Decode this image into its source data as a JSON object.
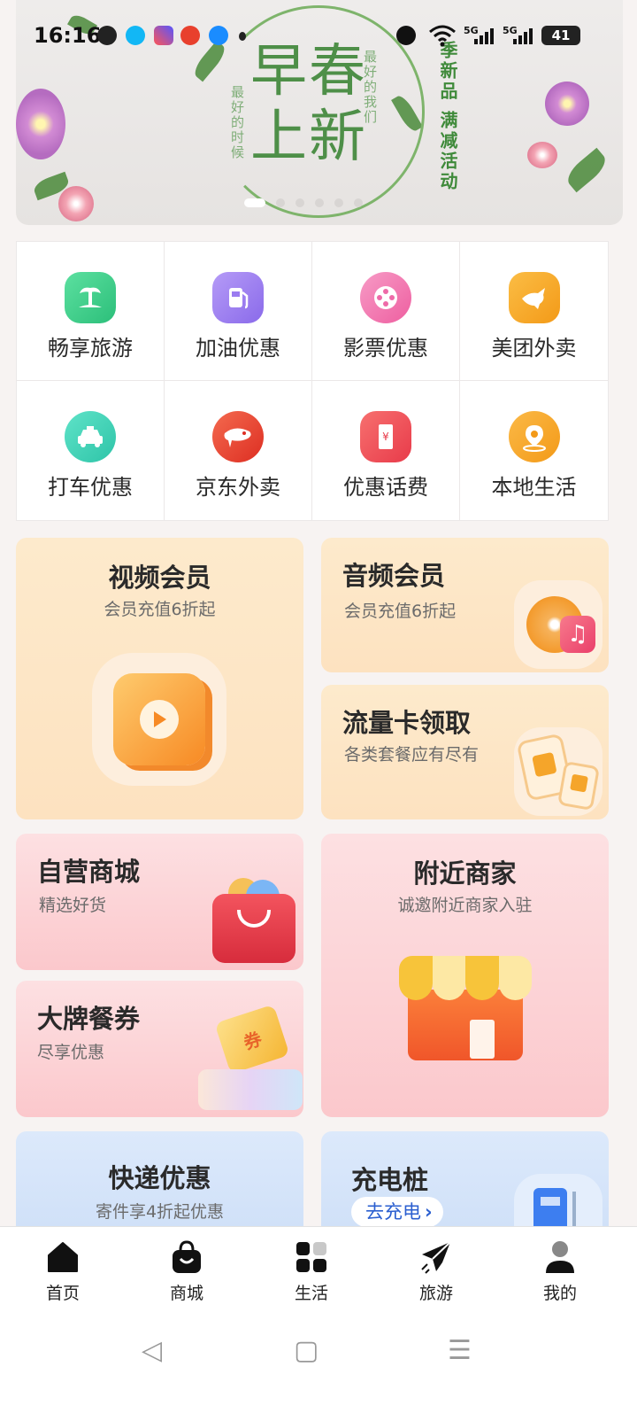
{
  "status_bar": {
    "time": "16:16",
    "network_1": "5G",
    "network_2": "5G",
    "battery": "41"
  },
  "banner": {
    "headline_top": "早春",
    "headline_bottom": "上新",
    "side_text_left": "最好的时候",
    "side_text_right": "最好的我们",
    "promo_text": "季新品 满减活动",
    "slide_count": 6,
    "active_slide": 1
  },
  "services": [
    {
      "label": "畅享旅游",
      "icon": "palm-tree-icon",
      "color": "#3ecb8a"
    },
    {
      "label": "加油优惠",
      "icon": "fuel-pump-icon",
      "color": "#9b7cf0"
    },
    {
      "label": "影票优惠",
      "icon": "film-reel-icon",
      "color": "#f07ab0"
    },
    {
      "label": "美团外卖",
      "icon": "kangaroo-icon",
      "color": "#f5a52a"
    },
    {
      "label": "打车优惠",
      "icon": "taxi-icon",
      "color": "#3dd0b5"
    },
    {
      "label": "京东外卖",
      "icon": "jd-dog-icon",
      "color": "#e8402d"
    },
    {
      "label": "优惠话费",
      "icon": "phone-bill-icon",
      "color": "#f0505a"
    },
    {
      "label": "本地生活",
      "icon": "location-pin-icon",
      "color": "#f5a52a"
    }
  ],
  "cards": {
    "video": {
      "title": "视频会员",
      "subtitle": "会员充值6折起"
    },
    "audio": {
      "title": "音频会员",
      "subtitle": "会员充值6折起"
    },
    "data_card": {
      "title": "流量卡领取",
      "subtitle": "各类套餐应有尽有"
    },
    "mall": {
      "title": "自营商城",
      "subtitle": "精选好货"
    },
    "nearby": {
      "title": "附近商家",
      "subtitle": "诚邀附近商家入驻"
    },
    "coupon": {
      "title": "大牌餐券",
      "subtitle": "尽享优惠",
      "badge": "券"
    },
    "express": {
      "title": "快递优惠",
      "subtitle": "寄件享4折起优惠"
    },
    "charging": {
      "title": "充电桩",
      "button": "去充电"
    }
  },
  "bottom_nav": [
    {
      "label": "首页",
      "icon": "home-icon"
    },
    {
      "label": "商城",
      "icon": "shopping-bag-icon"
    },
    {
      "label": "生活",
      "icon": "grid-icon"
    },
    {
      "label": "旅游",
      "icon": "paper-plane-icon"
    },
    {
      "label": "我的",
      "icon": "user-icon"
    }
  ],
  "system_nav": {
    "back": "◁",
    "home": "▢",
    "menu": "☰"
  }
}
